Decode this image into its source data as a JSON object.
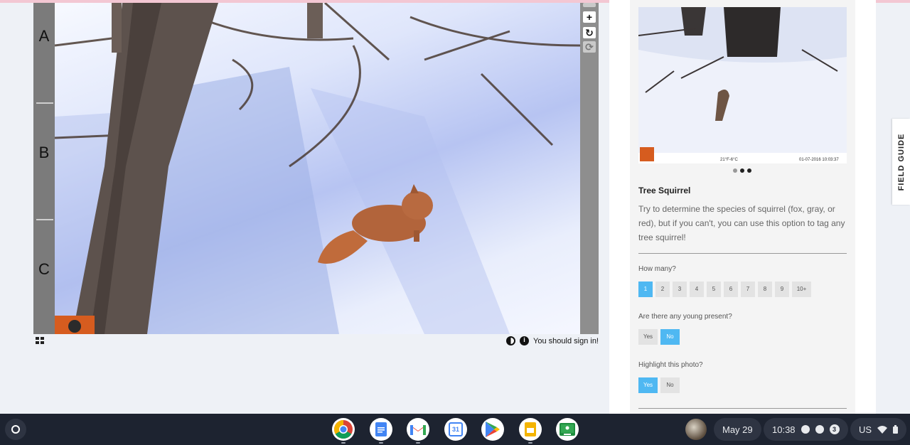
{
  "viewer": {
    "row_labels": [
      "A",
      "B",
      "C"
    ],
    "tools": {
      "zoom_in": "+",
      "rotate": "↻",
      "reset": "⟳"
    },
    "sign_in_notice": "You should sign in!"
  },
  "panel": {
    "carousel_dots": 3,
    "carousel_active_index": 1,
    "species_name": "Tree Squirrel",
    "species_description": "Try to determine the species of squirrel (fox, gray, or red), but if you can't, you can use this option to tag any tree squirrel!",
    "thumb_stamp": "21°F-6°C",
    "thumb_date": "01-07-2016 10:03:37",
    "questions": {
      "how_many": {
        "label": "How many?",
        "options": [
          "1",
          "2",
          "3",
          "4",
          "5",
          "6",
          "7",
          "8",
          "9",
          "10+"
        ],
        "selected": "1"
      },
      "young": {
        "label": "Are there any young present?",
        "options": [
          "Yes",
          "No"
        ],
        "selected": "No"
      },
      "highlight": {
        "label": "Highlight this photo?",
        "options": [
          "Yes",
          "No"
        ],
        "selected": "Yes"
      }
    }
  },
  "field_guide_label": "FIELD GUIDE",
  "taskbar": {
    "apps": [
      "chrome-icon",
      "docs-icon",
      "gmail-icon",
      "calendar-icon",
      "play-store-icon",
      "slides-icon",
      "classroom-icon"
    ],
    "calendar_day": "31",
    "date": "May 29",
    "time": "10:38",
    "notification_count": "3",
    "locale": "US"
  },
  "colors": {
    "selected_option": "#4fb8f2",
    "taskbar": "#1d2330"
  }
}
